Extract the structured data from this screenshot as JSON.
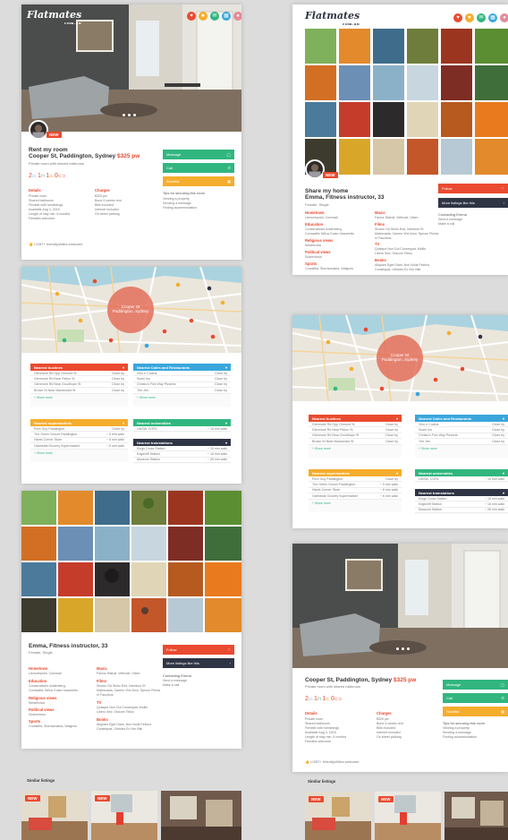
{
  "brand": {
    "logo_text": "Flatmates",
    "logo_sub": "com.au"
  },
  "header_icons": [
    "heart-icon",
    "star-icon",
    "chat-icon",
    "calendar-icon",
    "profile-icon"
  ],
  "colors": {
    "red": "#ea4a2f",
    "green": "#31b67f",
    "orange": "#f5ad2d",
    "blue": "#3aa6dc",
    "dark": "#2f3544"
  },
  "listing": {
    "badge": "NEW",
    "heading": "Rent my room",
    "address": "Cooper St, Paddington, Sydney",
    "price": "$325 pw",
    "subtitle": "Private room with shared bathroom",
    "stats": {
      "bedrooms": "2",
      "bathrooms": "1",
      "people": "1",
      "parking": "0"
    },
    "details": {
      "title": "Details",
      "lines": "Private room\nShared bathroom\nFlexible with furnishings\nAvailable Aug 3, 2016\nLength of stay min. 6 months\nFemales welcome"
    },
    "charges": {
      "title": "Charges",
      "lines": "$325 pw\nBond 4 weeks rent\nBills included\nInternet included\nOn street parking"
    },
    "welcome": "LGBT+ friendly/Allies welcome",
    "buttons": {
      "message": "Message",
      "call": "Call",
      "shortlist": "Shortlist"
    },
    "tips": {
      "title": "Tips for securing this room",
      "lines": "Viewing a property\nSending a message\nFinding accommodation"
    }
  },
  "map": {
    "label_line1": "Cooper St",
    "label_line2": "Paddington, Sydney"
  },
  "nearby": {
    "buslines": {
      "title": "Nearest buslines",
      "rows": [
        {
          "name": "Glenmore Rd Opp Ormond St",
          "dist": "Close by"
        },
        {
          "name": "Glenmore Rd Near Pelion St",
          "dist": "Close by"
        },
        {
          "name": "Glenmore Rd Near Goodhope St",
          "dist": "Close by"
        },
        {
          "name": "Brown St Near Macdonald St",
          "dist": "Close by"
        }
      ],
      "more": "+ Show more"
    },
    "supermarkets": {
      "title": "Nearest supermarkets",
      "rows": [
        {
          "name": "Pure Guy Paddington",
          "dist": "Close by"
        },
        {
          "name": "The Green Grocer Paddington",
          "dist": "~ 5 min walk"
        },
        {
          "name": "Harris Corner Store",
          "dist": "~ 6 min walk"
        },
        {
          "name": "Oatmeals Grocery Supermarket",
          "dist": "~ 6 min walk"
        }
      ],
      "more": "+ Show more"
    },
    "cafes": {
      "title": "Nearest Cafes and Restaurants",
      "rows": [
        {
          "name": "Vino e Cucina",
          "dist": "Close by"
        },
        {
          "name": "Sushi Ino",
          "dist": "Close by"
        },
        {
          "name": "Christo's Five Way Pizzeria",
          "dist": "Close by"
        },
        {
          "name": "The Jim",
          "dist": "Close by"
        }
      ],
      "more": "+ Show more"
    },
    "universities": {
      "title": "Nearest universities",
      "rows": [
        {
          "name": "UNSW, COFA",
          "dist": "~ 15 min walk"
        }
      ]
    },
    "trainstations": {
      "title": "Nearest trainstations",
      "rows": [
        {
          "name": "Kings Cross Station",
          "dist": "~ 15 min walk"
        },
        {
          "name": "Edgecliff Station",
          "dist": "~ 16 min walk"
        },
        {
          "name": "Museum Station",
          "dist": "~ 26 min walk"
        }
      ]
    }
  },
  "profile": {
    "left_name": "Emma, Fitness instructor, 33",
    "right_heading": "Share my home",
    "right_name": "Emma, Fitness instructor, 33",
    "meta": "Female, Single",
    "hometown": {
      "title": "Hometown",
      "lines": "Lismorepoint, Cornwall"
    },
    "education": {
      "title": "Education",
      "lines": "Conservatoire Addenberg,\nCornwallis Tafica Gusto Ulazaretto"
    },
    "religious": {
      "title": "Religious views",
      "lines": "Westerosia"
    },
    "political": {
      "title": "Political views",
      "lines": "Scarecheus"
    },
    "sports": {
      "title": "Sports",
      "lines": "Crossfitia, Stormumalea, Walgrea"
    },
    "music": {
      "title": "Music",
      "lines": "Fanna, Blandi, Veltrude, Ulsen"
    },
    "films": {
      "title": "Films",
      "lines": "Shown Od Stullo Eed, Isterdum Et\nMalesuada, Cameo Vhe Arco, Spruce Pinnia\nIn Faucibus"
    },
    "tv": {
      "title": "TV",
      "lines": "Quisque Non Dui Consequat, Mollis\nLibero Sed, Ostcum Tellus"
    },
    "books": {
      "title": "Books",
      "lines": "Aliquam Eget Diam, Non Nulla Finibus\nConsequat, Ultricies Ex Nor Nisl"
    },
    "follow": "Follow",
    "more_listings": "More listings like this",
    "contact_title": "Contacting Emma",
    "contact_lines": "Send a message\nMake a call"
  },
  "similar": {
    "title": "Similar listings",
    "badge": "NEW"
  }
}
